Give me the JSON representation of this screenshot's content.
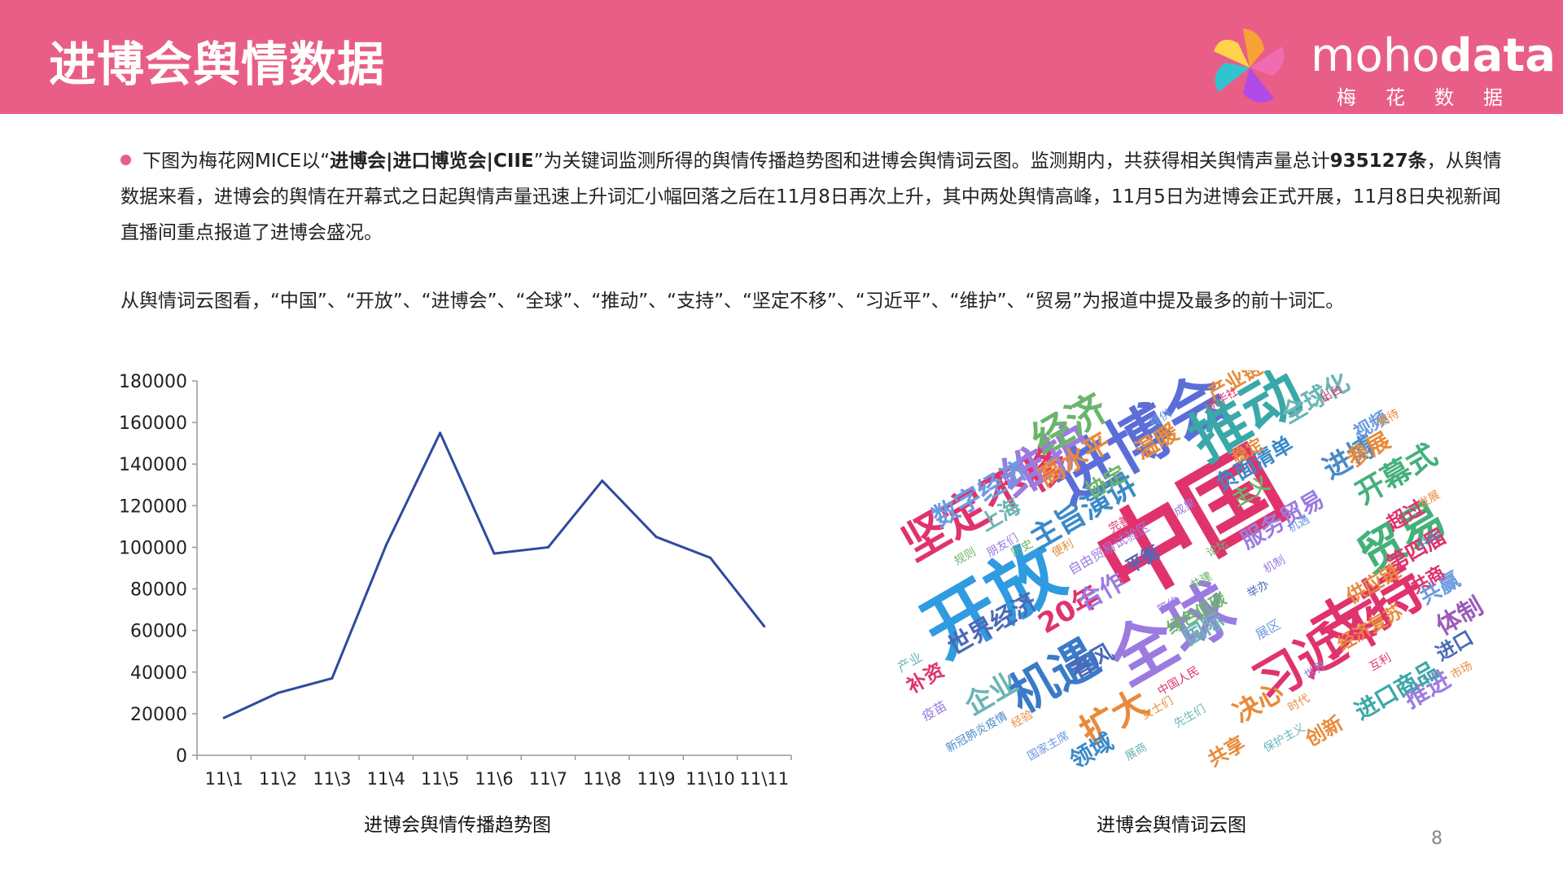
{
  "header": {
    "title": "进博会舆情数据",
    "logo_main_light": "moho",
    "logo_main_bold": "data",
    "logo_sub": "梅花数据"
  },
  "paragraph1": {
    "s1": "下图为梅花网MICE以“",
    "b1": "进博会|进口博览会|CIIE",
    "s2": "”为关键词监测所得的舆情传播趋势图和进博会舆情词云图。监测期内，共获得相关舆情声量总计",
    "b2": "935127条",
    "s3": "，从舆情数据来看，进博会的舆情在开幕式之日起舆情声量迅速上升词汇小幅回落之后在11月8日再次上升，其中两处舆情高峰，11月5日为进博会正式开展，11月8日央视新闻直播间重点报道了进博会盛况。"
  },
  "paragraph2": "从舆情词云图看，“中国”、“开放”、“进博会”、“全球”、“推动”、“支持”、“坚定不移”、“习近平”、“维护”、“贸易”为报道中提及最多的前十词汇。",
  "chart_data": {
    "type": "line",
    "categories": [
      "11\\1",
      "11\\2",
      "11\\3",
      "11\\4",
      "11\\5",
      "11\\6",
      "11\\7",
      "11\\8",
      "11\\9",
      "11\\10",
      "11\\11"
    ],
    "values": [
      18000,
      30000,
      37000,
      101000,
      155000,
      97000,
      100000,
      132000,
      105000,
      95000,
      62000
    ],
    "ylim": [
      0,
      180000
    ],
    "yticks": [
      0,
      20000,
      40000,
      60000,
      80000,
      100000,
      120000,
      140000,
      160000,
      180000
    ],
    "line_color": "#2e4a9e",
    "grid": false
  },
  "captions": {
    "left": "进博会舆情传播趋势图",
    "right": "进博会舆情词云图"
  },
  "word_cloud": [
    {
      "t": "中国",
      "c": "#e0336d"
    },
    {
      "t": "开放",
      "c": "#2f9be0"
    },
    {
      "t": "进博会",
      "c": "#5b6ed8"
    },
    {
      "t": "全球",
      "c": "#9c7be0"
    },
    {
      "t": "推动",
      "c": "#3aa8a8"
    },
    {
      "t": "支持",
      "c": "#e0336d"
    },
    {
      "t": "坚定不移",
      "c": "#e0336d"
    },
    {
      "t": "习近平",
      "c": "#e0336d"
    },
    {
      "t": "维护",
      "c": "#9c7be0"
    },
    {
      "t": "贸易",
      "c": "#44b07a"
    },
    {
      "t": "机遇",
      "c": "#3a7ac8"
    },
    {
      "t": "经济",
      "c": "#6bb56b"
    },
    {
      "t": "扩大",
      "c": "#e98a3a"
    },
    {
      "t": "主旨演讲",
      "c": "#3a8ac8"
    },
    {
      "t": "开幕式",
      "c": "#44b07a"
    },
    {
      "t": "全球化",
      "c": "#6bb5b5"
    },
    {
      "t": "数字经济",
      "c": "#6b9be0"
    },
    {
      "t": "世界经济",
      "c": "#4a6ab8"
    },
    {
      "t": "进博",
      "c": "#4a8ac8"
    },
    {
      "t": "决心",
      "c": "#e98a3a"
    },
    {
      "t": "企业",
      "c": "#6bb5b5"
    },
    {
      "t": "体制",
      "c": "#9c5bb8"
    },
    {
      "t": "20年",
      "c": "#e0336d"
    },
    {
      "t": "第四届",
      "c": "#e0336d"
    },
    {
      "t": "高水平",
      "c": "#e98a3a"
    },
    {
      "t": "共赢",
      "c": "#6b9be0"
    },
    {
      "t": "合作",
      "c": "#9c7be0"
    },
    {
      "t": "服务贸易",
      "c": "#9c7be0"
    },
    {
      "t": "领域",
      "c": "#3a8ac8"
    },
    {
      "t": "共享",
      "c": "#e98a3a"
    },
    {
      "t": "推进",
      "c": "#9c7be0"
    },
    {
      "t": "产业链",
      "c": "#e98a3a"
    },
    {
      "t": "春风",
      "c": "#4a6ab8"
    },
    {
      "t": "温暖",
      "c": "#e98a3a"
    },
    {
      "t": "参展",
      "c": "#e98a3a"
    },
    {
      "t": "负面清单",
      "c": "#3a8ac8"
    },
    {
      "t": "上海",
      "c": "#6bb5b5"
    },
    {
      "t": "协定",
      "c": "#6bb56b"
    },
    {
      "t": "平衡",
      "c": "#4a6ab8"
    },
    {
      "t": "主义",
      "c": "#6bb56b"
    },
    {
      "t": "超过",
      "c": "#e0336d"
    },
    {
      "t": "创新",
      "c": "#e98a3a"
    },
    {
      "t": "进口商品",
      "c": "#3aa8a8"
    },
    {
      "t": "进口",
      "c": "#4a6ab8"
    },
    {
      "t": "共商",
      "c": "#e0336d"
    },
    {
      "t": "补资",
      "c": "#e0336d"
    },
    {
      "t": "国际",
      "c": "#6bb5b5"
    },
    {
      "t": "供应链",
      "c": "#e98a3a"
    },
    {
      "t": "经济复苏",
      "c": "#e98a3a"
    },
    {
      "t": "视频",
      "c": "#6b9be0"
    },
    {
      "t": "稳定",
      "c": "#e98a3a"
    },
    {
      "t": "自由贸易试验区",
      "c": "#9c7be0"
    },
    {
      "t": "绿色低碳",
      "c": "#6bb56b"
    },
    {
      "t": "新华社",
      "c": "#e0336d"
    },
    {
      "t": "产业",
      "c": "#6bb5b5"
    },
    {
      "t": "疫苗",
      "c": "#9c7be0"
    },
    {
      "t": "展区",
      "c": "#6b9be0"
    },
    {
      "t": "经验",
      "c": "#e98a3a"
    },
    {
      "t": "朋友们",
      "c": "#9c7be0"
    },
    {
      "t": "历史",
      "c": "#6bb56b"
    },
    {
      "t": "时代",
      "c": "#e98a3a"
    },
    {
      "t": "国家主席",
      "c": "#6b9be0"
    },
    {
      "t": "新冠肺炎疫情",
      "c": "#4a8ac8"
    },
    {
      "t": "保护主义",
      "c": "#6bb5b5"
    },
    {
      "t": "中国人民",
      "c": "#e0336d"
    },
    {
      "t": "世界",
      "c": "#9c7be0"
    },
    {
      "t": "机遇",
      "c": "#6b9be0"
    },
    {
      "t": "发展",
      "c": "#e98a3a"
    },
    {
      "t": "共建",
      "c": "#6bb56b"
    },
    {
      "t": "女士们",
      "c": "#e98a3a"
    },
    {
      "t": "先生们",
      "c": "#6bb5b5"
    },
    {
      "t": "成果",
      "c": "#9c7be0"
    },
    {
      "t": "互利",
      "c": "#e0336d"
    },
    {
      "t": "共同",
      "c": "#4a8ac8"
    },
    {
      "t": "市场",
      "c": "#e98a3a"
    },
    {
      "t": "规则",
      "c": "#6bb56b"
    },
    {
      "t": "机制",
      "c": "#9c7be0"
    },
    {
      "t": "完善",
      "c": "#e0336d"
    },
    {
      "t": "提供",
      "c": "#6b9be0"
    },
    {
      "t": "便利",
      "c": "#e98a3a"
    },
    {
      "t": "展商",
      "c": "#6bb5b5"
    },
    {
      "t": "签约",
      "c": "#9c7be0"
    },
    {
      "t": "论坛",
      "c": "#6bb56b"
    },
    {
      "t": "出台",
      "c": "#e0336d"
    },
    {
      "t": "举办",
      "c": "#4a6ab8"
    },
    {
      "t": "期待",
      "c": "#e98a3a"
    }
  ]
}
